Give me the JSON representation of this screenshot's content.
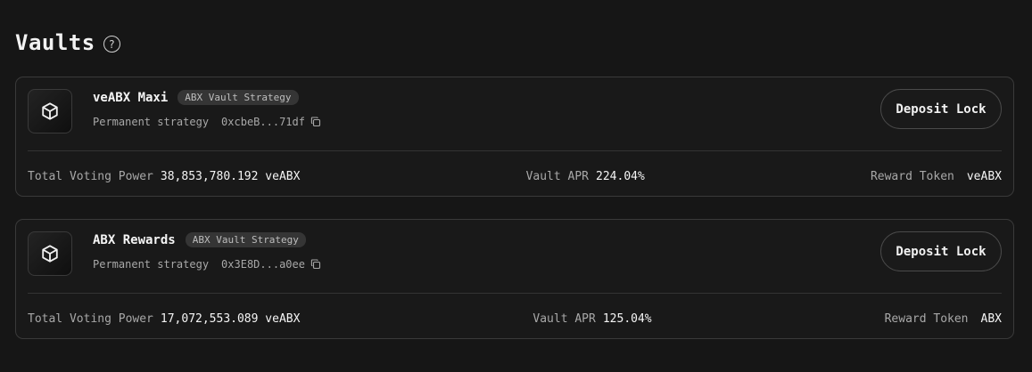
{
  "header": {
    "title": "Vaults",
    "help_glyph": "?"
  },
  "vaults": [
    {
      "name": "veABX Maxi",
      "badge": "ABX Vault Strategy",
      "strategy_type": "Permanent strategy",
      "address": "0xcbeB...71df",
      "deposit_label": "Deposit Lock",
      "total_voting_power_label": "Total Voting Power",
      "total_voting_power": "38,853,780.192 veABX",
      "apr_label": "Vault APR",
      "apr": "224.04%",
      "reward_label": "Reward Token",
      "reward_token": "veABX"
    },
    {
      "name": "ABX Rewards",
      "badge": "ABX Vault Strategy",
      "strategy_type": "Permanent strategy",
      "address": "0x3E8D...a0ee",
      "deposit_label": "Deposit Lock",
      "total_voting_power_label": "Total Voting Power",
      "total_voting_power": "17,072,553.089 veABX",
      "apr_label": "Vault APR",
      "apr": "125.04%",
      "reward_label": "Reward Token",
      "reward_token": "ABX"
    }
  ],
  "icons": {
    "vault": "cube-icon",
    "help": "help-icon",
    "copy": "copy-icon"
  },
  "colors": {
    "background": "#161616",
    "card_border": "#3a3a3a",
    "text_primary": "#f5f5f5",
    "text_secondary": "#a8a8a8"
  }
}
